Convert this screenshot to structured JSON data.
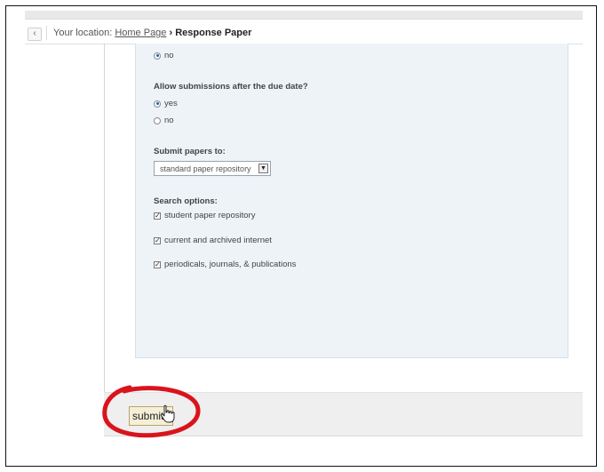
{
  "breadcrumb": {
    "back_icon": "chevron-left-icon",
    "prefix": "Your location:",
    "home": "Home Page",
    "separator": "›",
    "current": "Response Paper"
  },
  "form": {
    "prev_radio_no": "no",
    "late_submissions": {
      "label": "Allow submissions after the due date?",
      "yes": "yes",
      "no": "no",
      "selected": "yes"
    },
    "submit_to": {
      "label": "Submit papers to:",
      "value": "standard paper repository"
    },
    "search_options": {
      "label": "Search options:",
      "items": [
        {
          "label": "student paper repository",
          "checked": true
        },
        {
          "label": "current and archived internet",
          "checked": true
        },
        {
          "label": "periodicals, journals, & publications",
          "checked": true
        }
      ]
    }
  },
  "submit_label": "submit",
  "annotation_color": "#d9141c",
  "cursor_icon": "hand-pointer-icon"
}
